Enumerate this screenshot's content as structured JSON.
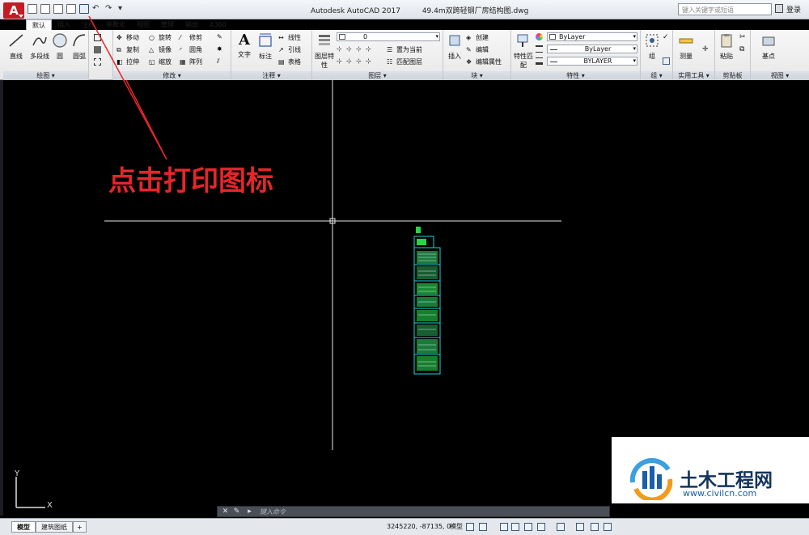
{
  "titlebar": {
    "app_title": "Autodesk AutoCAD 2017",
    "file_name": "49.4m双跨轻钢厂房结构图.dwg",
    "search_placeholder": "键入关键字或短语",
    "sign_in": "登录"
  },
  "tabs": [
    "默认",
    "插入",
    "注释",
    "参数化",
    "视图",
    "管理",
    "输出",
    "A360"
  ],
  "ribbon": {
    "draw": {
      "footer": "绘图 ▾",
      "items": [
        "直线",
        "多段线",
        "圆",
        "圆弧"
      ]
    },
    "modify": {
      "footer": "修改 ▾",
      "items": [
        "移动",
        "旋转",
        "修剪",
        "复制",
        "镜像",
        "圆角",
        "拉伸",
        "缩放",
        "阵列"
      ]
    },
    "annotation": {
      "footer": "注释 ▾",
      "items": [
        "文字",
        "标注",
        "线性",
        "引线",
        "表格"
      ]
    },
    "layers": {
      "footer": "图层 ▾",
      "items": [
        "图层特性",
        "置为当前",
        "匹配图层"
      ],
      "current_layer": "0"
    },
    "block": {
      "footer": "块 ▾",
      "items": [
        "插入",
        "创建",
        "编辑",
        "编辑属性"
      ]
    },
    "properties": {
      "footer": "特性 ▾",
      "items": [
        "特性匹配"
      ],
      "color": "ByLayer",
      "linetype": "ByLayer",
      "lineweight": "BYLAYER"
    },
    "group": {
      "footer": "组 ▾",
      "items": [
        "组"
      ]
    },
    "utilities": {
      "footer": "实用工具 ▾",
      "items": [
        "测量"
      ]
    },
    "clipboard": {
      "footer": "剪贴板",
      "items": [
        "粘贴"
      ]
    },
    "view": {
      "footer": "视图 ▾",
      "items": [
        "基点"
      ]
    }
  },
  "annotation": {
    "text": "点击打印图标",
    "color": "#e4262b"
  },
  "command": {
    "placeholder": "键入命令"
  },
  "status": {
    "layout_tabs": [
      "模型",
      "建筑图纸"
    ],
    "add_tab": "+",
    "coordinates": "3245220, -87135, 0",
    "model_label": "模型"
  },
  "ucs": {
    "x_label": "X",
    "y_label": "Y"
  },
  "watermark": {
    "title": "土木工程网",
    "url": "www.civilcn.com"
  },
  "colors": {
    "accent": "#c51b24",
    "drawing_green": "#27d44a",
    "drawing_cyan": "#1fd1d6",
    "crosshair": "#e8e8e8"
  }
}
